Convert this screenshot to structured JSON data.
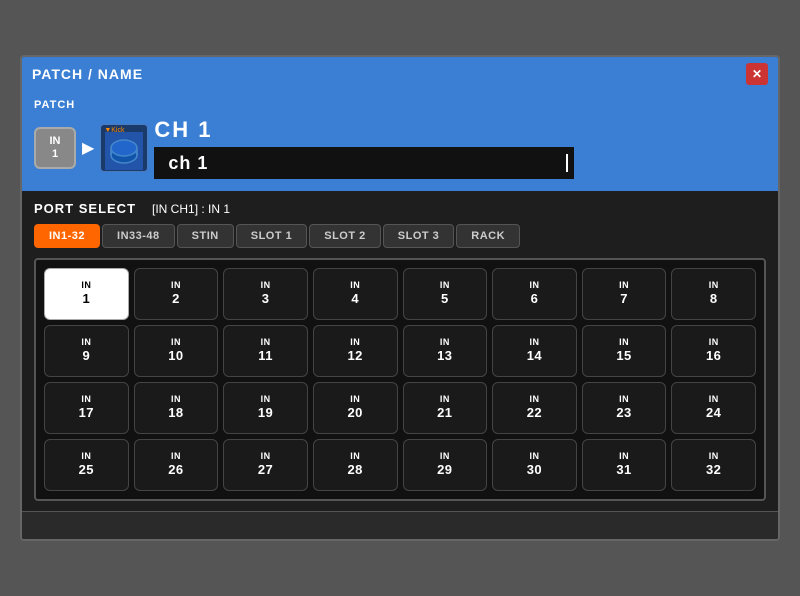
{
  "dialog": {
    "title": "PATCH / NAME",
    "close_label": "✕"
  },
  "patch": {
    "label": "PATCH",
    "btn_line1": "IN",
    "btn_line2": "1"
  },
  "channel": {
    "icon_label": "▼Kick",
    "title": "CH  1",
    "name_value": "ch 1"
  },
  "port_select": {
    "label": "PORT SELECT",
    "status": "[IN CH1] : IN 1"
  },
  "tabs": [
    {
      "id": "in1-32",
      "label": "IN1-32",
      "active": true
    },
    {
      "id": "in33-48",
      "label": "IN33-48",
      "active": false
    },
    {
      "id": "stin",
      "label": "STIN",
      "active": false
    },
    {
      "id": "slot1",
      "label": "SLOT 1",
      "active": false
    },
    {
      "id": "slot2",
      "label": "SLOT 2",
      "active": false
    },
    {
      "id": "slot3",
      "label": "SLOT 3",
      "active": false
    },
    {
      "id": "rack",
      "label": "RACK",
      "active": false
    }
  ],
  "grid": [
    {
      "top": "IN",
      "num": "1",
      "selected": true
    },
    {
      "top": "IN",
      "num": "2",
      "selected": false
    },
    {
      "top": "IN",
      "num": "3",
      "selected": false
    },
    {
      "top": "IN",
      "num": "4",
      "selected": false
    },
    {
      "top": "IN",
      "num": "5",
      "selected": false
    },
    {
      "top": "IN",
      "num": "6",
      "selected": false
    },
    {
      "top": "IN",
      "num": "7",
      "selected": false
    },
    {
      "top": "IN",
      "num": "8",
      "selected": false
    },
    {
      "top": "IN",
      "num": "9",
      "selected": false
    },
    {
      "top": "IN",
      "num": "10",
      "selected": false
    },
    {
      "top": "IN",
      "num": "11",
      "selected": false
    },
    {
      "top": "IN",
      "num": "12",
      "selected": false
    },
    {
      "top": "IN",
      "num": "13",
      "selected": false
    },
    {
      "top": "IN",
      "num": "14",
      "selected": false
    },
    {
      "top": "IN",
      "num": "15",
      "selected": false
    },
    {
      "top": "IN",
      "num": "16",
      "selected": false
    },
    {
      "top": "IN",
      "num": "17",
      "selected": false
    },
    {
      "top": "IN",
      "num": "18",
      "selected": false
    },
    {
      "top": "IN",
      "num": "19",
      "selected": false
    },
    {
      "top": "IN",
      "num": "20",
      "selected": false
    },
    {
      "top": "IN",
      "num": "21",
      "selected": false
    },
    {
      "top": "IN",
      "num": "22",
      "selected": false
    },
    {
      "top": "IN",
      "num": "23",
      "selected": false
    },
    {
      "top": "IN",
      "num": "24",
      "selected": false
    },
    {
      "top": "IN",
      "num": "25",
      "selected": false
    },
    {
      "top": "IN",
      "num": "26",
      "selected": false
    },
    {
      "top": "IN",
      "num": "27",
      "selected": false
    },
    {
      "top": "IN",
      "num": "28",
      "selected": false
    },
    {
      "top": "IN",
      "num": "29",
      "selected": false
    },
    {
      "top": "IN",
      "num": "30",
      "selected": false
    },
    {
      "top": "IN",
      "num": "31",
      "selected": false
    },
    {
      "top": "IN",
      "num": "32",
      "selected": false
    }
  ]
}
